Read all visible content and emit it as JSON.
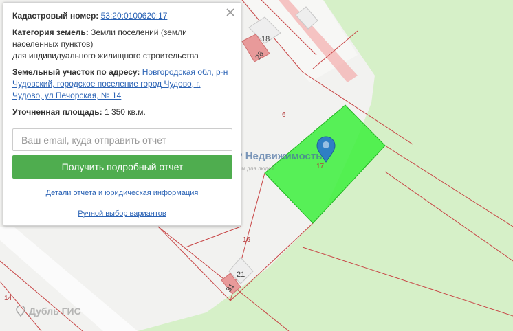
{
  "popup": {
    "cadastral_label": "Кадастровый номер:",
    "cadastral_number": "53:20:0100620:17",
    "category_label": "Категория земель:",
    "category_line1": "Земли поселений (земли",
    "category_line2": "населенных пунктов)",
    "category_line3": "для индивидуального жилищного строительства",
    "address_label": "Земельный участок по адресу:",
    "address_line1": "Новгородская обл, р-н",
    "address_line2": "Чудовский, городское поселение город Чудово, г.",
    "address_line3": "Чудово, ул Печорская, № 14",
    "area_label": "Уточненная площадь:",
    "area_value": "1 350 кв.м.",
    "email_placeholder": "Ваш email, куда отправить отчет",
    "report_button": "Получить подробный отчет",
    "details_link": "Детали отчета и юридическая информация",
    "manual_link": "Ручной выбор вариантов"
  },
  "map": {
    "plot_labels": {
      "p6": "6",
      "p17": "17",
      "p16": "16",
      "p14": "14"
    },
    "house_labels": {
      "h18": "18",
      "h28": "28",
      "h21": "21",
      "h31": "31"
    },
    "watermark": {
      "title": "ДАР Недвижимость",
      "subtitle": "работаем для людей"
    },
    "provider": "Дубль ГИС",
    "colors": {
      "selected_plot": "#3cf03c",
      "boundary": "#c84646",
      "forest": "#d6f0c8",
      "pin": "#2f7fc4",
      "button": "#4fad4f"
    }
  }
}
